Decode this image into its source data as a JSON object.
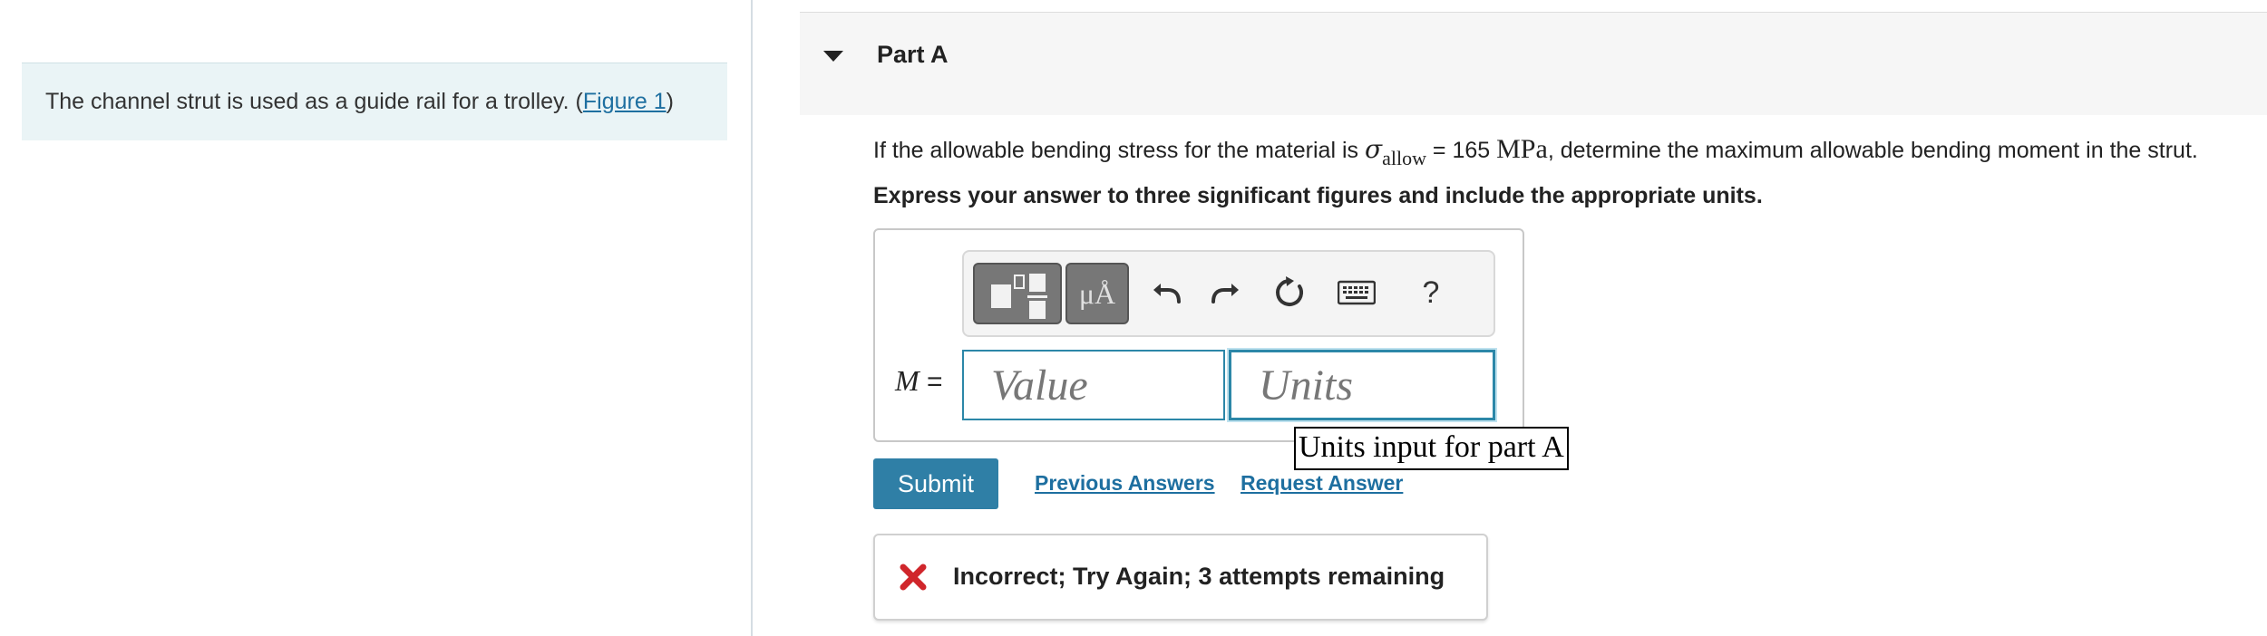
{
  "left": {
    "intro_text": "The channel strut is used as a guide rail for a trolley. (",
    "figure_link": "Figure 1",
    "intro_close": ")"
  },
  "part": {
    "caret_icon": "caret-down-icon",
    "title": "Part A"
  },
  "question": {
    "prefix": "If the allowable bending stress for the material is ",
    "symbol": "σ",
    "subscript": "allow",
    "equals": " = 165 ",
    "unit": "MPa",
    "suffix": ", determine the maximum allowable bending moment in the strut."
  },
  "instruction": "Express your answer to three significant figures and include the appropriate units.",
  "toolbar": {
    "templates_icon": "templates-icon",
    "symbols_label": "μÅ",
    "undo_icon": "undo-icon",
    "redo_icon": "redo-icon",
    "reset_icon": "reset-icon",
    "keyboard_icon": "keyboard-icon",
    "help_label": "?"
  },
  "answer": {
    "variable": "M",
    "equals": " =",
    "value_placeholder": "Value",
    "units_placeholder": "Units",
    "units_tooltip": "Units input for part A"
  },
  "actions": {
    "submit_label": "Submit",
    "previous_answers": "Previous Answers",
    "request_answer": "Request Answer"
  },
  "feedback": {
    "icon": "x-icon",
    "message": "Incorrect; Try Again; 3 attempts remaining",
    "color": "#d0262b"
  },
  "colors": {
    "accent": "#2f7fa6",
    "link": "#1e6fa0",
    "panel_bg": "#eaf4f6"
  }
}
